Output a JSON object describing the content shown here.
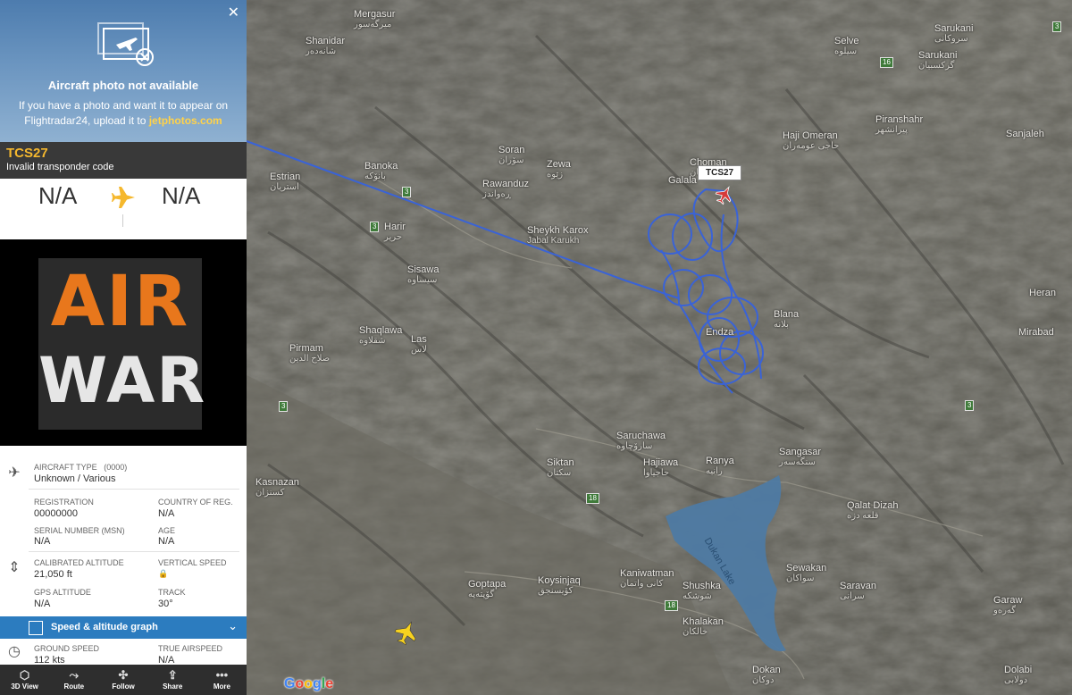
{
  "photo": {
    "title": "Aircraft photo not available",
    "text_before": "If you have a photo and want it to appear on Flightradar24, upload it to ",
    "link": "jetphotos.com"
  },
  "flight": {
    "callsign": "TCS27",
    "status": "Invalid transponder code",
    "from": "N/A",
    "to": "N/A"
  },
  "airline_logo": {
    "line1": "AIR",
    "line2": "WAR"
  },
  "details": {
    "aircraft_type_label": "AIRCRAFT TYPE",
    "aircraft_type_code": "(0000)",
    "aircraft_type_value": "Unknown / Various",
    "registration_label": "REGISTRATION",
    "registration_value": "00000000",
    "country_label": "COUNTRY OF REG.",
    "country_value": "N/A",
    "msn_label": "SERIAL NUMBER (MSN)",
    "msn_value": "N/A",
    "age_label": "AGE",
    "age_value": "N/A",
    "cal_alt_label": "CALIBRATED ALTITUDE",
    "cal_alt_value": "21,050 ft",
    "vs_label": "VERTICAL SPEED",
    "gps_alt_label": "GPS ALTITUDE",
    "gps_alt_value": "N/A",
    "track_label": "TRACK",
    "track_value": "30°",
    "graph_label": "Speed & altitude graph",
    "ground_speed_label": "GROUND SPEED",
    "ground_speed_value": "112 kts",
    "tas_label": "TRUE AIRSPEED",
    "tas_value": "N/A"
  },
  "toolbar": [
    {
      "label": "3D View",
      "icon": "3d-cube-icon"
    },
    {
      "label": "Route",
      "icon": "route-icon"
    },
    {
      "label": "Follow",
      "icon": "follow-icon"
    },
    {
      "label": "Share",
      "icon": "share-icon"
    },
    {
      "label": "More",
      "icon": "more-icon"
    }
  ],
  "map": {
    "flight_tag": "TCS27",
    "lake": "Dukan Lake",
    "attribution": "Google",
    "places": [
      {
        "name": "Mergasur",
        "ar": "میرگەسور"
      },
      {
        "name": "Shanidar",
        "ar": "شانەدەر"
      },
      {
        "name": "Selve",
        "ar": "سیلوه"
      },
      {
        "name": "Sarukani",
        "ar": "سروکانی"
      },
      {
        "name": "Sarukani",
        "ar": "گرکسبیان"
      },
      {
        "name": "Piranshahr",
        "ar": "پیرانشهر"
      },
      {
        "name": "Haji Omeran",
        "ar": "حاجی عومەران"
      },
      {
        "name": "Sanjaleh",
        "ar": ""
      },
      {
        "name": "Soran",
        "ar": "سۆران"
      },
      {
        "name": "Zewa",
        "ar": "زێوه"
      },
      {
        "name": "Choman",
        "ar": "چۆمان"
      },
      {
        "name": "Galala",
        "ar": ""
      },
      {
        "name": "Banoka",
        "ar": "بانۆکه"
      },
      {
        "name": "Estrian",
        "ar": "استریان"
      },
      {
        "name": "Rawanduz",
        "ar": "ڕەواندز"
      },
      {
        "name": "Sheykh Karox",
        "ar": "Jabal Karukh"
      },
      {
        "name": "Harir",
        "ar": "حریر"
      },
      {
        "name": "Sisawa",
        "ar": "سیساوه"
      },
      {
        "name": "Shaqlawa",
        "ar": "شقلاوه"
      },
      {
        "name": "Las",
        "ar": "لاس"
      },
      {
        "name": "Pirmam",
        "ar": "صلاح الدین"
      },
      {
        "name": "Blana",
        "ar": "بلانه"
      },
      {
        "name": "Endza",
        "ar": ""
      },
      {
        "name": "Heran",
        "ar": ""
      },
      {
        "name": "Mirabad",
        "ar": ""
      },
      {
        "name": "Saruchawa",
        "ar": "سارۆچاوه"
      },
      {
        "name": "Hajiawa",
        "ar": "حاجیاوا"
      },
      {
        "name": "Siktan",
        "ar": "سکتان"
      },
      {
        "name": "Ranya",
        "ar": "رانیه"
      },
      {
        "name": "Sangasar",
        "ar": "سنگەسەر"
      },
      {
        "name": "Qalat Dizah",
        "ar": "قلعه دزه"
      },
      {
        "name": "Kasnazan",
        "ar": "کسنزان"
      },
      {
        "name": "Goptapa",
        "ar": "گۆپتەپە"
      },
      {
        "name": "Koysinjaq",
        "ar": "کۆیسنجق"
      },
      {
        "name": "Kaniwatman",
        "ar": "کانی واتمان"
      },
      {
        "name": "Shushka",
        "ar": "شوشکه"
      },
      {
        "name": "Sewakan",
        "ar": "سواکان"
      },
      {
        "name": "Saravan",
        "ar": "سرانی"
      },
      {
        "name": "Garaw",
        "ar": "گەرەو"
      },
      {
        "name": "Khalakan",
        "ar": "خالکان"
      },
      {
        "name": "Dokan",
        "ar": "دوکان"
      },
      {
        "name": "Dolabi",
        "ar": "دولابی"
      }
    ],
    "roads": [
      "3",
      "3",
      "18",
      "3",
      "18",
      "3",
      "16",
      "3"
    ]
  }
}
